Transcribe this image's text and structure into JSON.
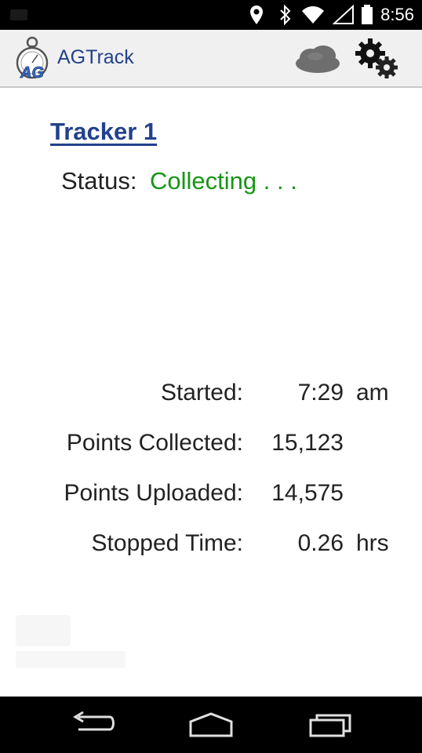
{
  "status_bar": {
    "time": "8:56",
    "icons": [
      "notification-icon",
      "location-icon",
      "bluetooth-icon",
      "wifi-icon",
      "signal-icon",
      "battery-icon"
    ]
  },
  "app_bar": {
    "logo_text": "AG",
    "title": "AGTrack",
    "actions": [
      "cloud-upload-icon",
      "settings-gears-icon"
    ]
  },
  "tracker": {
    "title": "Tracker 1",
    "status_label": "Status:",
    "status_value": "Collecting . . .",
    "status_color": "#169616"
  },
  "stats": [
    {
      "label": "Started:",
      "value": "7:29",
      "unit": "am"
    },
    {
      "label": "Points Collected:",
      "value": "15,123",
      "unit": ""
    },
    {
      "label": "Points Uploaded:",
      "value": "14,575",
      "unit": ""
    },
    {
      "label": "Stopped Time:",
      "value": "0.26",
      "unit": "hrs"
    }
  ],
  "nav_bar": {
    "buttons": [
      "back-icon",
      "home-icon",
      "recents-icon"
    ]
  },
  "colors": {
    "brand": "#23418b",
    "status_bar": "#000000",
    "action_bar": "#f0f0f0"
  }
}
